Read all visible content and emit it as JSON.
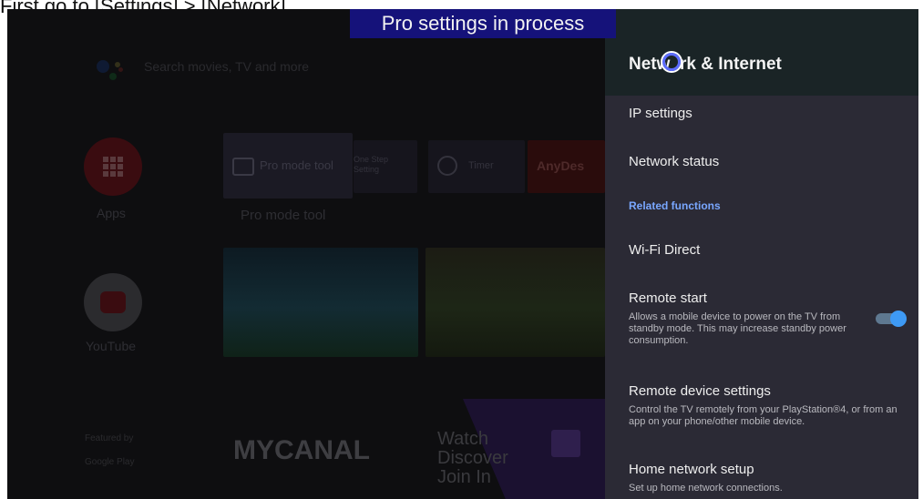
{
  "caption": "First go to [Settings] > [Network]",
  "banner": "Pro settings in process",
  "home": {
    "search_placeholder": "Search movies, TV and more",
    "apps_label": "Apps",
    "youtube_label": "YouTube",
    "tiles": {
      "pro_mode": "Pro mode tool",
      "one_step": "One Step Setting",
      "timer": "Timer",
      "anydesk": "AnyDes"
    },
    "pro_mode_label": "Pro mode tool",
    "mycanal": "MYCANAL",
    "twitch_text": [
      "Watch",
      "Discover",
      "Join In"
    ],
    "featured_by": "Featured by",
    "google_play": "Google Play"
  },
  "panel": {
    "title": "Netw  rk & Internet",
    "related_header": "Related functions",
    "items": [
      {
        "title": "IP settings"
      },
      {
        "title": "Network status"
      },
      {
        "title": "Wi-Fi Direct"
      },
      {
        "title": "Remote start",
        "subtitle": "Allows a mobile device to power on the TV from standby mode. This may increase standby power consumption.",
        "toggle": "on"
      },
      {
        "title": "Remote device settings",
        "subtitle": "Control the TV remotely from your PlayStation®4, or from an app on your phone/other mobile device."
      },
      {
        "title": "Home network setup",
        "subtitle": "Set up home network connections."
      }
    ]
  },
  "colors": {
    "accent": "#3e9af5",
    "related": "#79a7ff",
    "banner": "#15127a",
    "panel": "#2b2a35"
  }
}
